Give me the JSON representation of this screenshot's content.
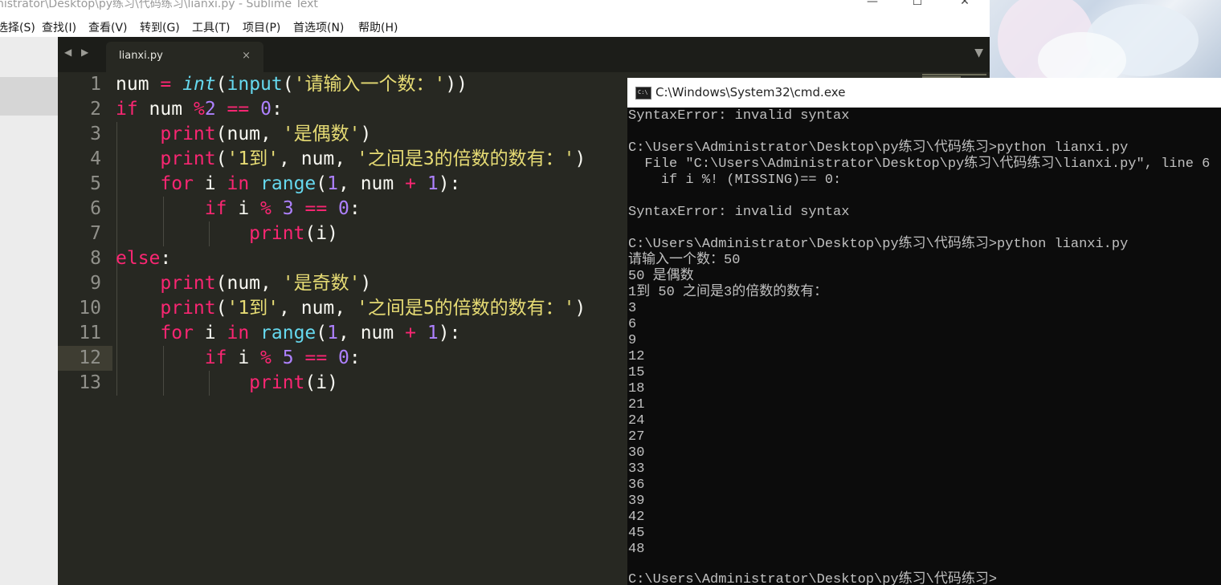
{
  "window": {
    "title": "nistrator\\Desktop\\py练习\\代码练习\\lianxi.py - Sublime Text"
  },
  "menu": [
    "选择(S)",
    "查找(I)",
    "查看(V)",
    "转到(G)",
    "工具(T)",
    "项目(P)",
    "首选项(N)",
    "帮助(H)"
  ],
  "tab": {
    "name": "lianxi.py",
    "close": "×"
  },
  "nav_arrows": "◀ ▶",
  "dropdown": "▼",
  "editor": {
    "line_numbers": [
      "1",
      "2",
      "3",
      "4",
      "5",
      "6",
      "7",
      "8",
      "9",
      "10",
      "11",
      "12",
      "13"
    ],
    "current_line": 12
  },
  "cmd": {
    "title": "C:\\Windows\\System32\\cmd.exe",
    "icon_text": "C:\\",
    "lines": [
      "SyntaxError: invalid syntax",
      "",
      "C:\\Users\\Administrator\\Desktop\\py练习\\代码练习>python lianxi.py",
      "  File \"C:\\Users\\Administrator\\Desktop\\py练习\\代码练习\\lianxi.py\", line 6",
      "    if i %! (MISSING)== 0:",
      "",
      "SyntaxError: invalid syntax",
      "",
      "C:\\Users\\Administrator\\Desktop\\py练习\\代码练习>python lianxi.py",
      "请输入一个数：50",
      "50 是偶数",
      "1到 50 之间是3的倍数的数有：",
      "3",
      "6",
      "9",
      "12",
      "15",
      "18",
      "21",
      "24",
      "27",
      "30",
      "33",
      "36",
      "39",
      "42",
      "45",
      "48",
      "",
      "C:\\Users\\Administrator\\Desktop\\py练习\\代码练习>"
    ]
  }
}
